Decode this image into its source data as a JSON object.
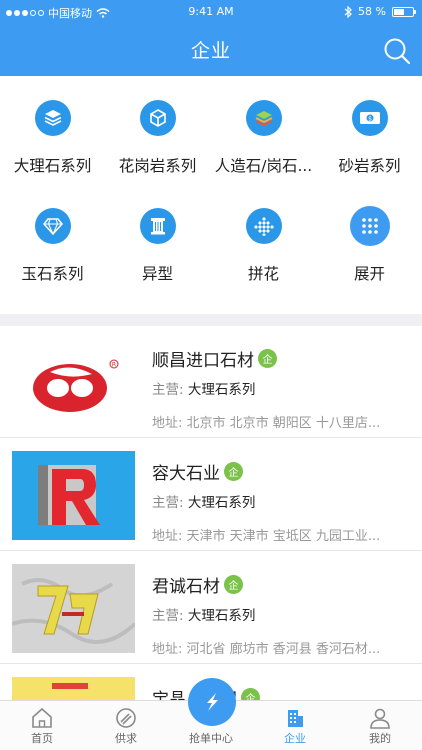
{
  "status_bar": {
    "carrier": "中国移动",
    "time": "9:41 AM",
    "battery": "58 %",
    "battery_level": 0.58
  },
  "header": {
    "title": "企业"
  },
  "categories": [
    {
      "label": "大理石系列",
      "icon": "layers-icon"
    },
    {
      "label": "花岗岩系列",
      "icon": "cube-icon"
    },
    {
      "label": "人造石/岗石...",
      "icon": "stack-icon"
    },
    {
      "label": "砂岩系列",
      "icon": "money-icon"
    },
    {
      "label": "玉石系列",
      "icon": "diamond-icon"
    },
    {
      "label": "异型",
      "icon": "column-icon"
    },
    {
      "label": "拼花",
      "icon": "pattern-icon"
    },
    {
      "label": "展开",
      "icon": "grid-icon"
    }
  ],
  "companies": [
    {
      "name": "顺昌进口石材",
      "badge": "企",
      "main_label": "主营:",
      "main_value": "大理石系列",
      "address": "地址: 北京市 北京市 朝阳区 十八里店..."
    },
    {
      "name": "容大石业",
      "badge": "企",
      "main_label": "主营:",
      "main_value": "大理石系列",
      "address": "地址: 天津市 天津市 宝坻区 九园工业..."
    },
    {
      "name": "君诚石材",
      "badge": "企",
      "main_label": "主营:",
      "main_value": "大理石系列",
      "address": "地址: 河北省 廊坊市 香河县 香河石材..."
    },
    {
      "name": "宝晶……团",
      "badge": "企"
    }
  ],
  "tabs": [
    {
      "label": "首页",
      "icon": "home-icon"
    },
    {
      "label": "供求",
      "icon": "supply-icon"
    },
    {
      "label": "抢单中心",
      "icon": "lightning-icon"
    },
    {
      "label": "企业",
      "icon": "building-icon"
    },
    {
      "label": "我的",
      "icon": "person-icon"
    }
  ],
  "colors": {
    "accent": "#3d9cf2",
    "icon_blue": "#2b97e9",
    "badge_green": "#7bc24a"
  }
}
